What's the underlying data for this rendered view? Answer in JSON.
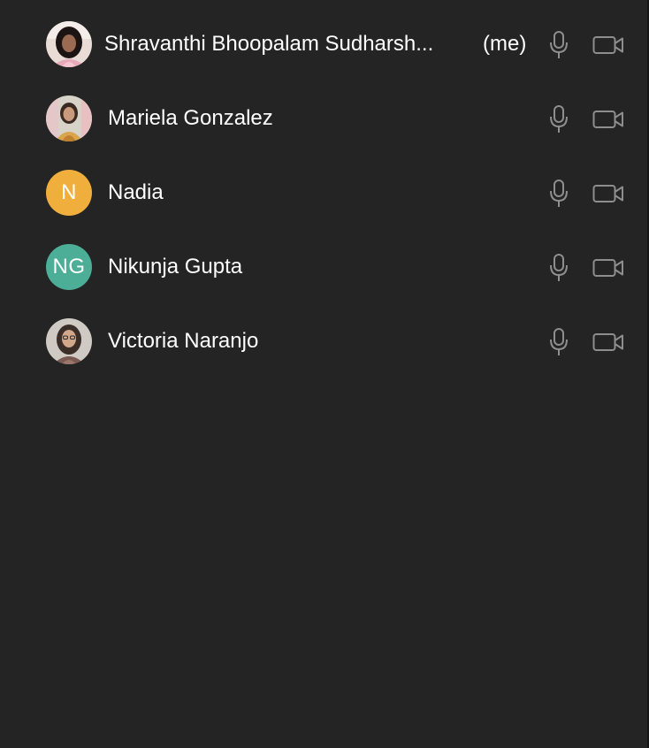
{
  "participants": [
    {
      "name": "Shravanthi Bhoopalam Sudharsh...",
      "self_tag": "(me)",
      "avatar": "photo",
      "mic_icon": "microphone-icon",
      "camera_icon": "video-camera-icon"
    },
    {
      "name": "Mariela Gonzalez",
      "avatar": "photo",
      "mic_icon": "microphone-icon",
      "camera_icon": "video-camera-icon"
    },
    {
      "name": "Nadia",
      "avatar": "initials",
      "initials": "N",
      "avatar_color": "#F0AF3C",
      "mic_icon": "microphone-icon",
      "camera_icon": "video-camera-icon"
    },
    {
      "name": "Nikunja Gupta",
      "avatar": "initials",
      "initials": "NG",
      "avatar_color": "#4CAE96",
      "mic_icon": "microphone-icon",
      "camera_icon": "video-camera-icon"
    },
    {
      "name": "Victoria Naranjo",
      "avatar": "photo",
      "mic_icon": "microphone-icon",
      "camera_icon": "video-camera-icon"
    }
  ],
  "colors": {
    "background": "#242424",
    "text": "#FFFFFF",
    "icon": "#8E8E8E"
  }
}
